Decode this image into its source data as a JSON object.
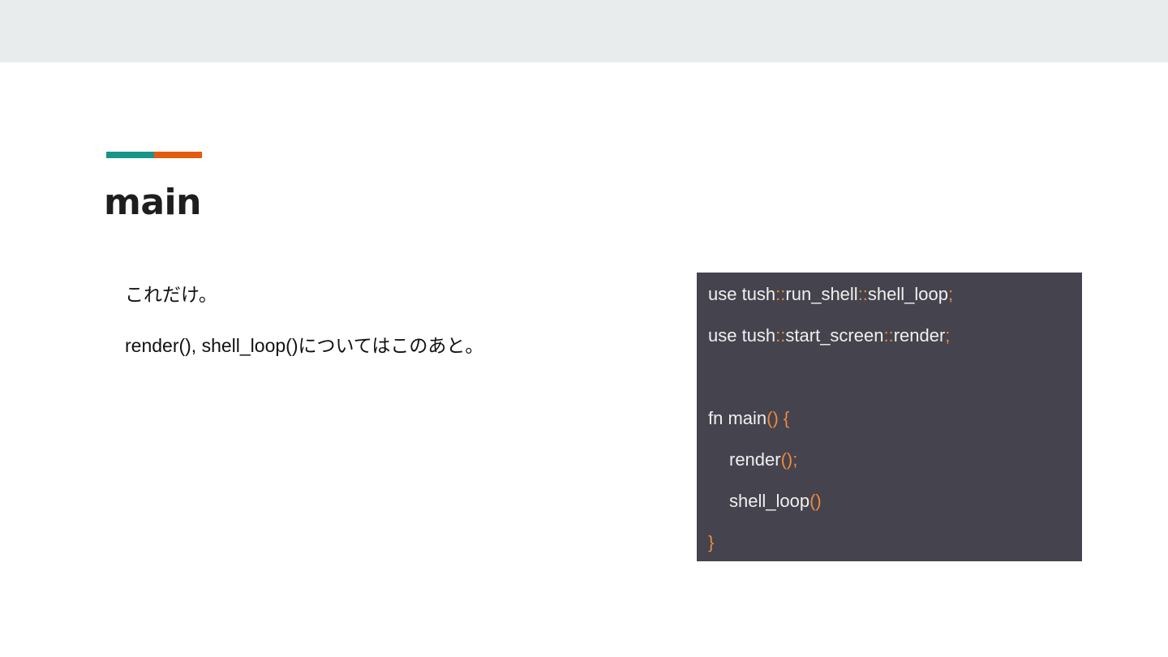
{
  "slide": {
    "title": "main",
    "body": [
      "これだけ。",
      "render(), shell_loop()についてはこのあと。"
    ]
  },
  "colors": {
    "top_band": "#e8eced",
    "accent_teal": "#1a9488",
    "accent_orange": "#e35b10",
    "code_background": "#45434d",
    "code_text": "#f0f0f0",
    "code_punctuation": "#f08a3c"
  },
  "code": {
    "lines": [
      {
        "indent": false,
        "tokens": [
          [
            "t",
            "use tush"
          ],
          [
            "p",
            "::"
          ],
          [
            "t",
            "run_shell"
          ],
          [
            "p",
            "::"
          ],
          [
            "t",
            "shell_loop"
          ],
          [
            "p",
            ";"
          ]
        ]
      },
      {
        "indent": false,
        "tokens": [
          [
            "t",
            "use tush"
          ],
          [
            "p",
            "::"
          ],
          [
            "t",
            "start_screen"
          ],
          [
            "p",
            "::"
          ],
          [
            "t",
            "render"
          ],
          [
            "p",
            ";"
          ]
        ]
      },
      {
        "indent": false,
        "tokens": []
      },
      {
        "indent": false,
        "tokens": [
          [
            "t",
            "fn main"
          ],
          [
            "p",
            "() {"
          ]
        ]
      },
      {
        "indent": true,
        "tokens": [
          [
            "t",
            "render"
          ],
          [
            "p",
            "();"
          ]
        ]
      },
      {
        "indent": true,
        "tokens": [
          [
            "t",
            "shell_loop"
          ],
          [
            "p",
            "()"
          ]
        ]
      },
      {
        "indent": false,
        "tokens": [
          [
            "p",
            "}"
          ]
        ]
      }
    ]
  }
}
